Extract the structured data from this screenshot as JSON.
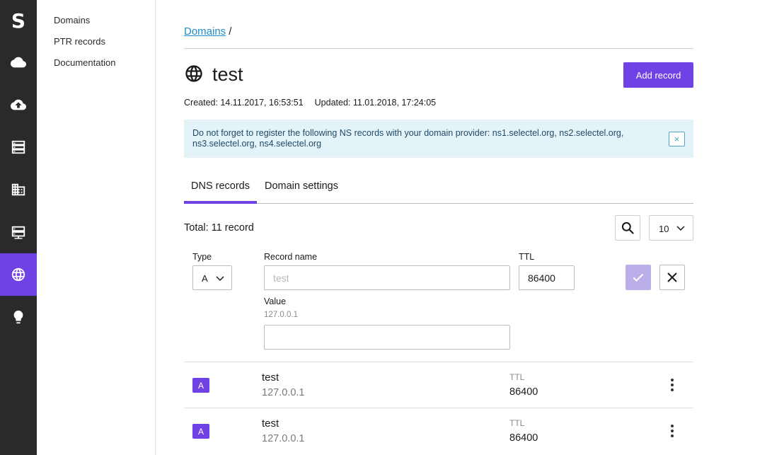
{
  "rail": {
    "logo": "S",
    "items": [
      {
        "icon": "cloud-icon"
      },
      {
        "icon": "cloud-upload-icon"
      },
      {
        "icon": "server-list-icon"
      },
      {
        "icon": "building-icon"
      },
      {
        "icon": "dedicated-server-icon"
      },
      {
        "icon": "globe-icon",
        "active": true
      },
      {
        "icon": "lightbulb-icon"
      }
    ]
  },
  "sidebar": {
    "items": [
      {
        "label": "Domains"
      },
      {
        "label": "PTR records"
      },
      {
        "label": "Documentation"
      }
    ]
  },
  "breadcrumb": {
    "link": "Domains",
    "separator": "/"
  },
  "domain": {
    "name": "test",
    "created": "Created: 14.11.2017, 16:53:51",
    "updated": "Updated: 11.01.2018, 17:24:05"
  },
  "actions": {
    "add_record": "Add record"
  },
  "alert": {
    "text": "Do not forget to register the following NS records with your domain provider: ns1.selectel.org, ns2.selectel.org, ns3.selectel.org, ns4.selectel.org",
    "close": "×"
  },
  "tabs": [
    {
      "label": "DNS records",
      "active": true
    },
    {
      "label": "Domain settings",
      "active": false
    }
  ],
  "toolbar": {
    "total": "Total: 11 record",
    "per_page": "10"
  },
  "form": {
    "type_label": "Type",
    "type_value": "A",
    "name_label": "Record name",
    "name_placeholder": "test",
    "ttl_label": "TTL",
    "ttl_value": "86400",
    "value_label": "Value",
    "value_hint": "127.0.0.1",
    "value_value": ""
  },
  "records": [
    {
      "type": "A",
      "name": "test",
      "value": "127.0.0.1",
      "ttl_label": "TTL",
      "ttl": "86400"
    },
    {
      "type": "A",
      "name": "test",
      "value": "127.0.0.1",
      "ttl_label": "TTL",
      "ttl": "86400"
    }
  ],
  "colors": {
    "accent": "#6f42e6",
    "rail": "#2a2a2d",
    "link": "#1f8dc4",
    "alert_bg": "#e3f3f8"
  }
}
